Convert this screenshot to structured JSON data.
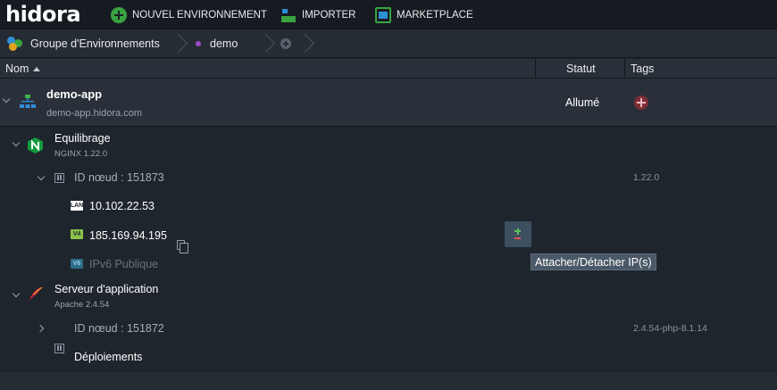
{
  "topbar": {
    "logo": "hidora",
    "new_env": "NOUVEL ENVIRONNEMENT",
    "import": "IMPORTER",
    "marketplace": "MARKETPLACE"
  },
  "breadcrumb": {
    "group": "Groupe d'Environnements",
    "env": "demo"
  },
  "table": {
    "col_name": "Nom",
    "col_status": "Statut",
    "col_tags": "Tags"
  },
  "env": {
    "name": "demo-app",
    "domain": "demo-app.hidora.com",
    "status": "Allumé"
  },
  "balancer": {
    "title": "Equilibrage",
    "software": "NGINX 1.22.0",
    "node_label": "ID nœud : 151873",
    "version": "1.22.0",
    "lan_badge": "LAN",
    "lan_ip": "10.102.22.53",
    "v4_badge": "V4",
    "public_ip": "185.169.94.195",
    "v6_badge": "V6",
    "ipv6_label": "IPv6 Publique"
  },
  "app_server": {
    "title": "Serveur d'application",
    "software": "Apache 2.4.54",
    "node_label": "ID nœud : 151872",
    "version": "2.4.54-php-8.1.14",
    "deployments": "Déploiements"
  },
  "tooltip": "Attacher/Détacher IP(s)",
  "colors": {
    "accent_green": "#3aa341",
    "nginx_green": "#129a3f",
    "apache_red": "#c7243a",
    "background": "#1f252d"
  }
}
